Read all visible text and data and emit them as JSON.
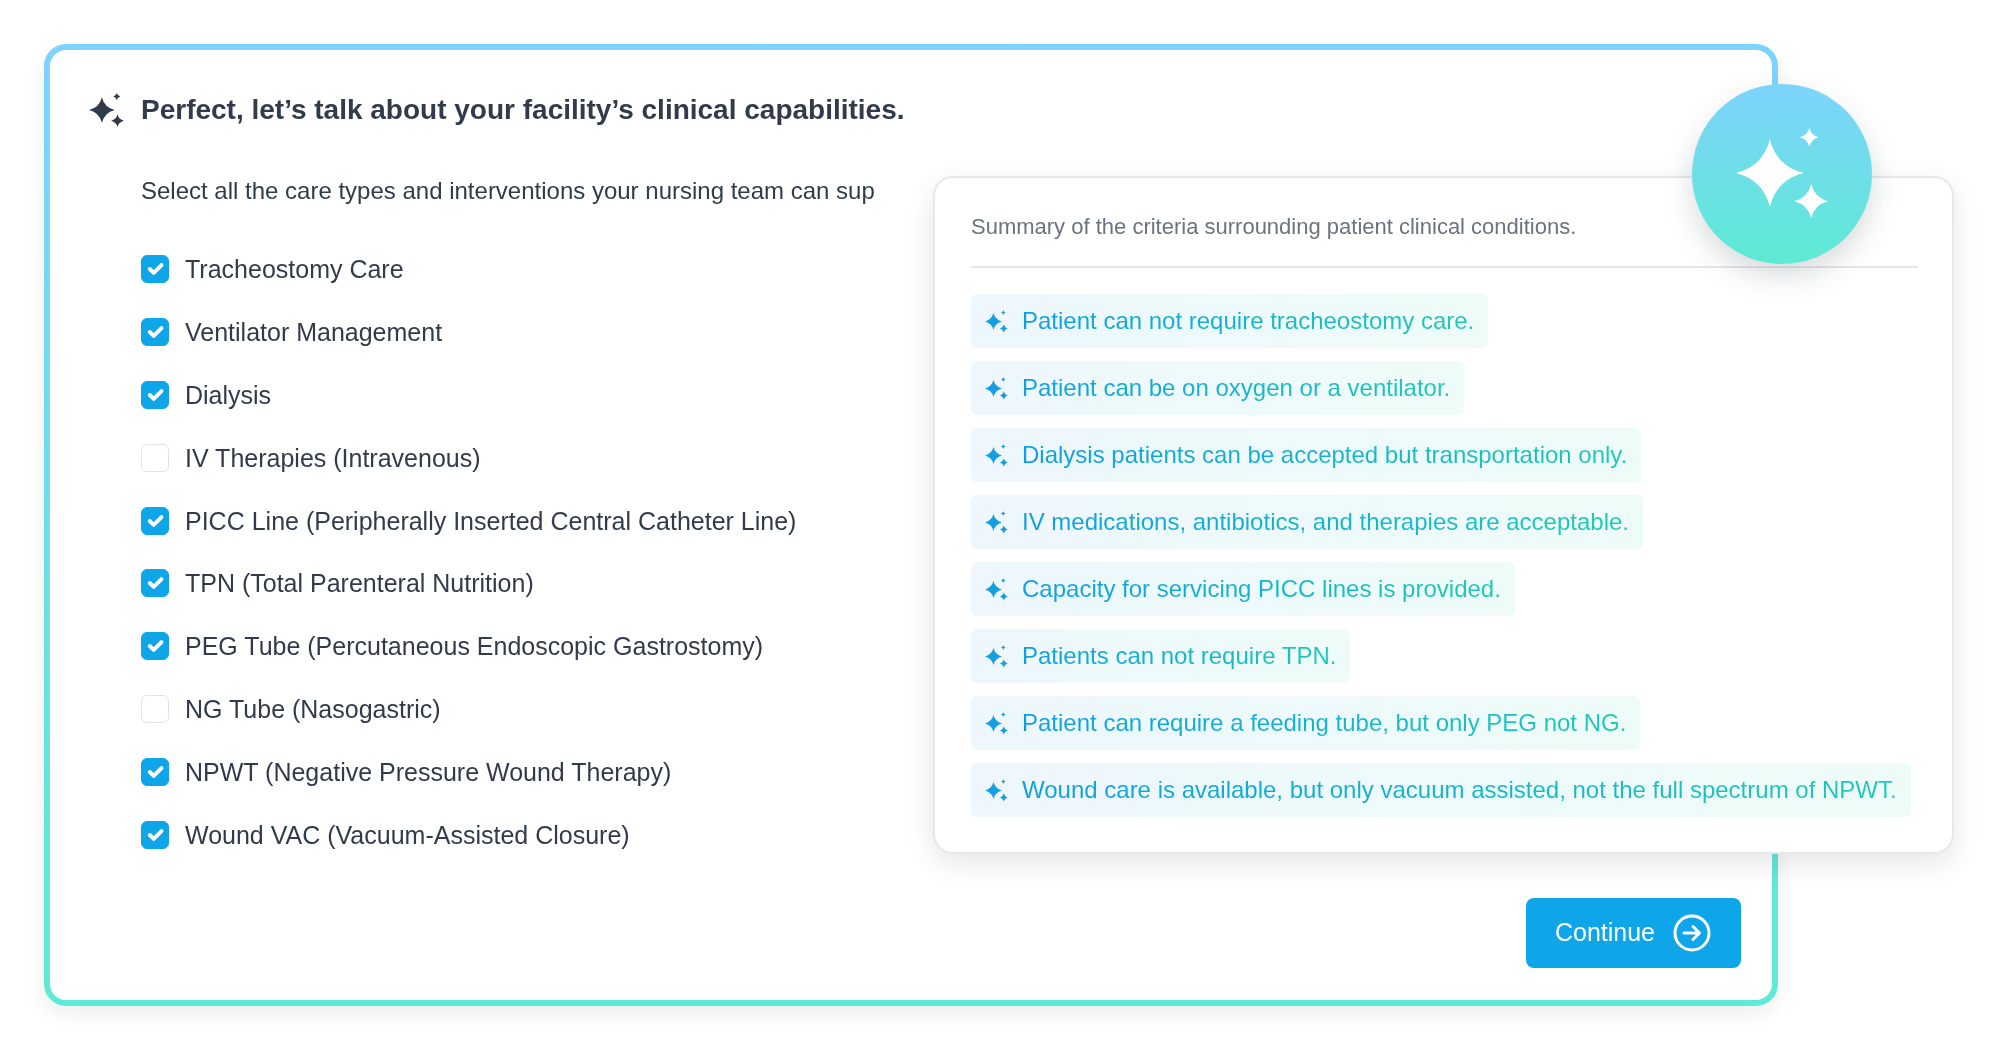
{
  "heading": "Perfect, let’s talk about your facility’s clinical capabilities.",
  "instructions": "Select all the care types and interventions your nursing team can sup",
  "care_types": [
    {
      "label": "Tracheostomy Care",
      "checked": true
    },
    {
      "label": "Ventilator Management",
      "checked": true
    },
    {
      "label": "Dialysis",
      "checked": true
    },
    {
      "label": "IV Therapies (Intravenous)",
      "checked": false
    },
    {
      "label": "PICC Line (Peripherally Inserted Central Catheter Line)",
      "checked": true
    },
    {
      "label": "TPN (Total Parenteral Nutrition)",
      "checked": true
    },
    {
      "label": "PEG Tube (Percutaneous Endoscopic Gastrostomy)",
      "checked": true
    },
    {
      "label": "NG Tube (Nasogastric)",
      "checked": false
    },
    {
      "label": "NPWT (Negative Pressure Wound Therapy)",
      "checked": true
    },
    {
      "label": "Wound VAC (Vacuum-Assisted Closure)",
      "checked": true
    }
  ],
  "summary": {
    "intro": "Summary of the criteria surrounding patient clinical conditions.",
    "criteria": [
      "Patient can not require tracheostomy care.",
      "Patient can be on oxygen or a ventilator.",
      "Dialysis patients can be accepted but transportation only.",
      "IV medications, antibiotics, and therapies are acceptable.",
      "Capacity for servicing PICC lines is provided.",
      "Patients can not require TPN.",
      "Patient can require a feeding tube, but only PEG not NG.",
      "Wound care is available, but only vacuum assisted, not the full spectrum of NPWT."
    ]
  },
  "continue_button": {
    "label": "Continue"
  }
}
